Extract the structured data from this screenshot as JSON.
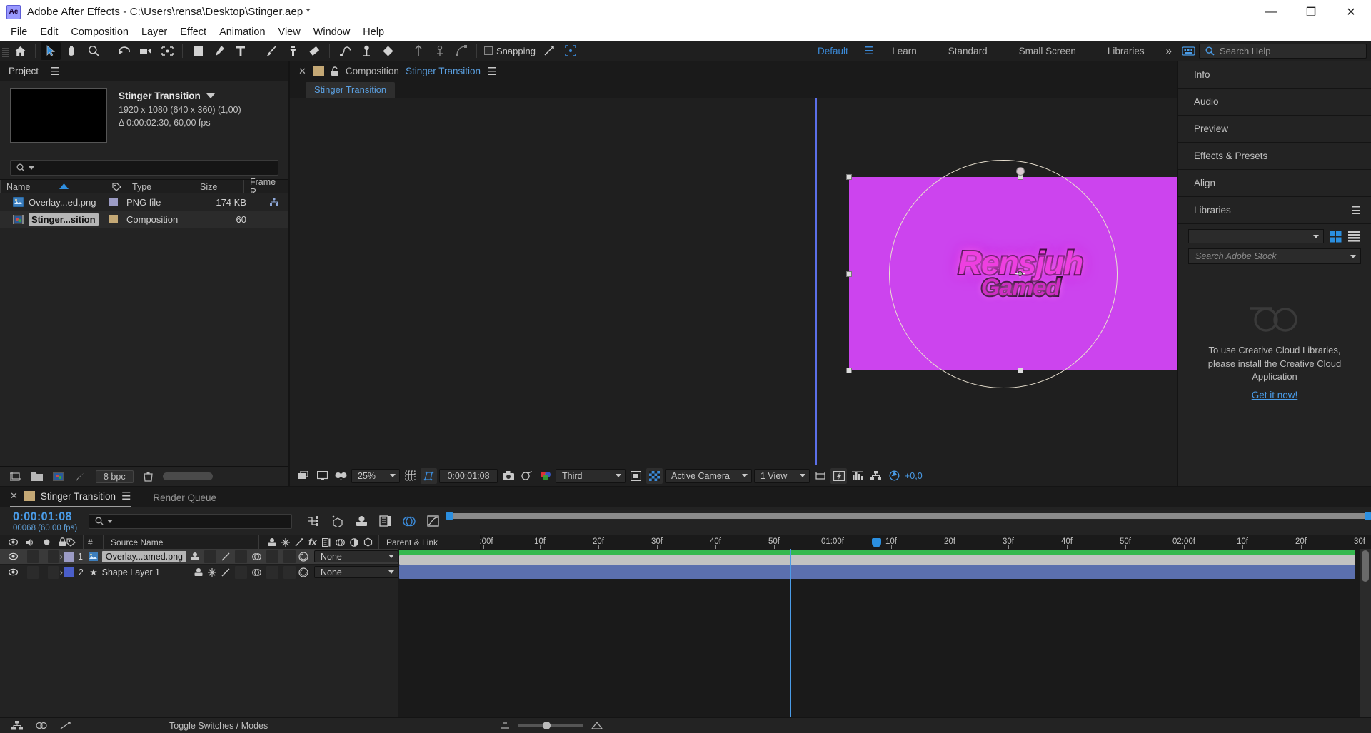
{
  "window": {
    "app_icon": "ae-logo-icon",
    "title": "Adobe After Effects - C:\\Users\\rensa\\Desktop\\Stinger.aep *",
    "minimize": "—",
    "maximize": "❐",
    "close": "✕"
  },
  "menu": {
    "items": [
      "File",
      "Edit",
      "Composition",
      "Layer",
      "Effect",
      "Animation",
      "View",
      "Window",
      "Help"
    ]
  },
  "toolbar": {
    "tools": [
      {
        "name": "home-icon",
        "active": false
      },
      {
        "name": "selection-tool-icon",
        "active": true
      },
      {
        "name": "hand-tool-icon",
        "active": false
      },
      {
        "name": "zoom-tool-icon",
        "active": false
      },
      {
        "name": "rotation-tool-icon",
        "active": false
      },
      {
        "name": "camera-tool-icon",
        "active": false
      },
      {
        "name": "pan-behind-tool-icon",
        "active": false
      },
      {
        "name": "rectangle-tool-icon",
        "active": false
      },
      {
        "name": "pen-tool-icon",
        "active": false
      },
      {
        "name": "type-tool-icon",
        "active": false
      },
      {
        "name": "brush-tool-icon",
        "active": false
      },
      {
        "name": "clone-stamp-tool-icon",
        "active": false
      },
      {
        "name": "eraser-tool-icon",
        "active": false
      },
      {
        "name": "roto-brush-tool-icon",
        "active": false
      },
      {
        "name": "puppet-pin-tool-icon",
        "active": false
      }
    ],
    "snapping_label": "Snapping",
    "snapping_checked": false,
    "workspaces": [
      {
        "label": "Default",
        "active": true
      },
      {
        "label": "Learn",
        "active": false
      },
      {
        "label": "Standard",
        "active": false
      },
      {
        "label": "Small Screen",
        "active": false
      },
      {
        "label": "Libraries",
        "active": false
      }
    ],
    "overflow": "»",
    "search_help_placeholder": "Search Help"
  },
  "project": {
    "tab_label": "Project",
    "comp_name": "Stinger Transition",
    "dimensions": "1920 x 1080  (640 x 360) (1,00)",
    "duration": "Δ 0:00:02:30, 60,00 fps",
    "search_placeholder": "",
    "columns": [
      "Name",
      "Type",
      "Size",
      "Frame R..."
    ],
    "items": [
      {
        "name": "Overlay...ed.png",
        "type": "PNG file",
        "size": "174 KB",
        "icon": "png-file-icon",
        "swatch": "#9b9bc4",
        "selected": false
      },
      {
        "name": "Stinger...sition",
        "type": "Composition",
        "size": "60",
        "icon": "composition-icon",
        "swatch": "#c4a875",
        "selected": true
      }
    ],
    "footer": {
      "bpc": "8 bpc"
    }
  },
  "composition": {
    "tab_prefix": "Composition",
    "tab_name": "Stinger Transition",
    "subtab": "Stinger Transition",
    "canvas": {
      "bg_color": "#cc44ee",
      "logo_line1": "Rensjuh",
      "logo_line2": "Gamed"
    },
    "bottom_bar": {
      "zoom": "25%",
      "timecode": "0:00:01:08",
      "resolution": "Third",
      "camera": "Active Camera",
      "views": "1 View",
      "offset": "+0,0"
    }
  },
  "right_dock": {
    "tabs": [
      "Info",
      "Audio",
      "Preview",
      "Effects & Presets",
      "Align"
    ],
    "libraries": {
      "title": "Libraries",
      "dropdown_value": "",
      "stock_placeholder": "Search Adobe Stock",
      "message_line1": "To use Creative Cloud Libraries,",
      "message_line2": "please install the Creative Cloud",
      "message_line3": "Application",
      "link": "Get it now!"
    }
  },
  "timeline": {
    "tab_active": "Stinger Transition",
    "tab_inactive": "Render Queue",
    "timecode": "0:00:01:08",
    "frames": "00068 (60.00 fps)",
    "search_placeholder": "",
    "columns": {
      "source_name": "Source Name",
      "number": "#",
      "parent_link": "Parent & Link"
    },
    "ruler_labels": [
      ":00f",
      "10f",
      "20f",
      "30f",
      "40f",
      "50f",
      "01:00f",
      "10f",
      "20f",
      "30f",
      "40f",
      "50f",
      "02:00f",
      "10f",
      "20f",
      "30f"
    ],
    "layers": [
      {
        "index": "1",
        "name": "Overlay...amed.png",
        "icon": "png-layer-icon",
        "color": "#9b9bc4",
        "parent": "None",
        "selected": true
      },
      {
        "index": "2",
        "name": "Shape Layer 1",
        "icon": "shape-layer-icon",
        "color": "#4a5ec9",
        "parent": "None",
        "selected": false
      }
    ],
    "footer_label": "Toggle Switches / Modes"
  }
}
